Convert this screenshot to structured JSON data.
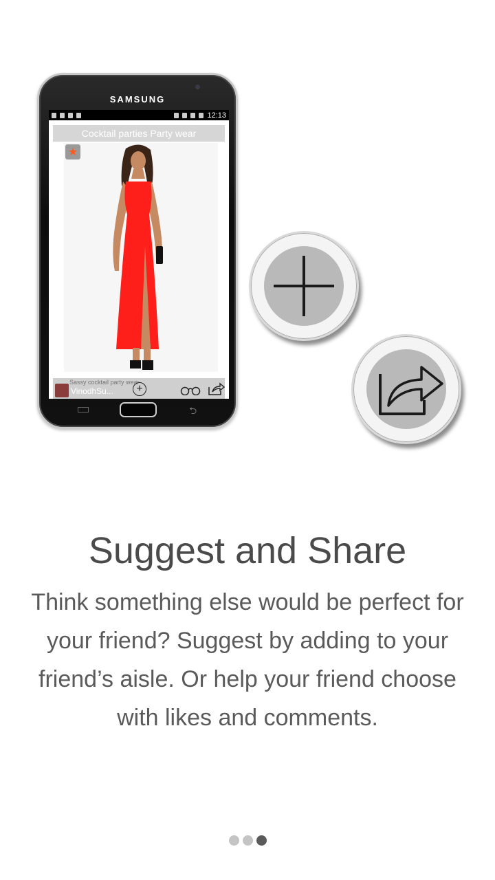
{
  "phone": {
    "brand": "SAMSUNG",
    "status_time": "12:13",
    "app_title": "Cocktail parties Party wear",
    "card_caption": "Sassy cocktail party wear",
    "card_user": "VinodhSu...",
    "icons": [
      "star-icon",
      "add-icon",
      "binoculars-icon",
      "share-icon"
    ]
  },
  "feature": {
    "title": "Suggest and Share",
    "description": "Think something else would be perfect for your friend? Suggest by adding to your friend’s aisle. Or help your friend choose with likes and comments."
  },
  "pager": {
    "count": 3,
    "active_index": 2
  },
  "colors": {
    "dress": "#ff1f1a",
    "star": "#ff5a1e",
    "text_title": "#4a4a4a",
    "text_body": "#5a5a5a"
  }
}
